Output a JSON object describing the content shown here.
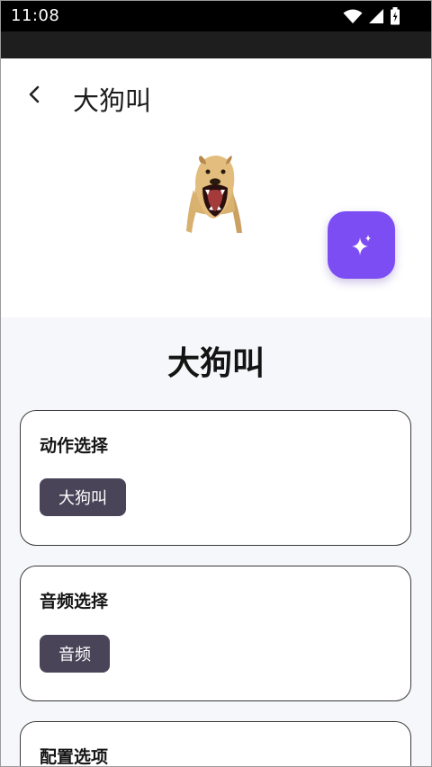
{
  "status_bar": {
    "time": "11:08"
  },
  "header": {
    "title": "大狗叫"
  },
  "effect": {
    "title": "大狗叫"
  },
  "cards": [
    {
      "title": "动作选择",
      "chip": "大狗叫"
    },
    {
      "title": "音频选择",
      "chip": "音频"
    },
    {
      "title": "配置选项"
    }
  ],
  "colors": {
    "accent": "#7d4df4",
    "chip_bg": "#4a4458",
    "page_bg": "#f6f7fa"
  }
}
